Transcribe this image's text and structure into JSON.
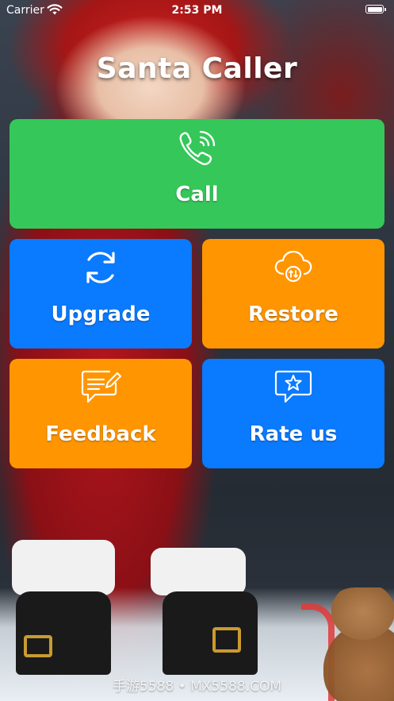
{
  "status_bar": {
    "carrier": "Carrier",
    "time": "2:53 PM",
    "wifi_icon": "wifi-icon",
    "battery_icon": "battery-icon"
  },
  "app": {
    "title": "Santa Caller"
  },
  "tiles": {
    "call": {
      "label": "Call",
      "icon": "phone-ringing-icon",
      "color": "#35c759"
    },
    "upgrade": {
      "label": "Upgrade",
      "icon": "refresh-icon",
      "color": "#0a7aff"
    },
    "restore": {
      "label": "Restore",
      "icon": "cloud-sync-icon",
      "color": "#ff9500"
    },
    "feedback": {
      "label": "Feedback",
      "icon": "message-edit-icon",
      "color": "#ff9500"
    },
    "rate": {
      "label": "Rate us",
      "icon": "star-message-icon",
      "color": "#0a7aff"
    }
  },
  "watermark": {
    "text": "手游5588 • MX5588.COM"
  }
}
